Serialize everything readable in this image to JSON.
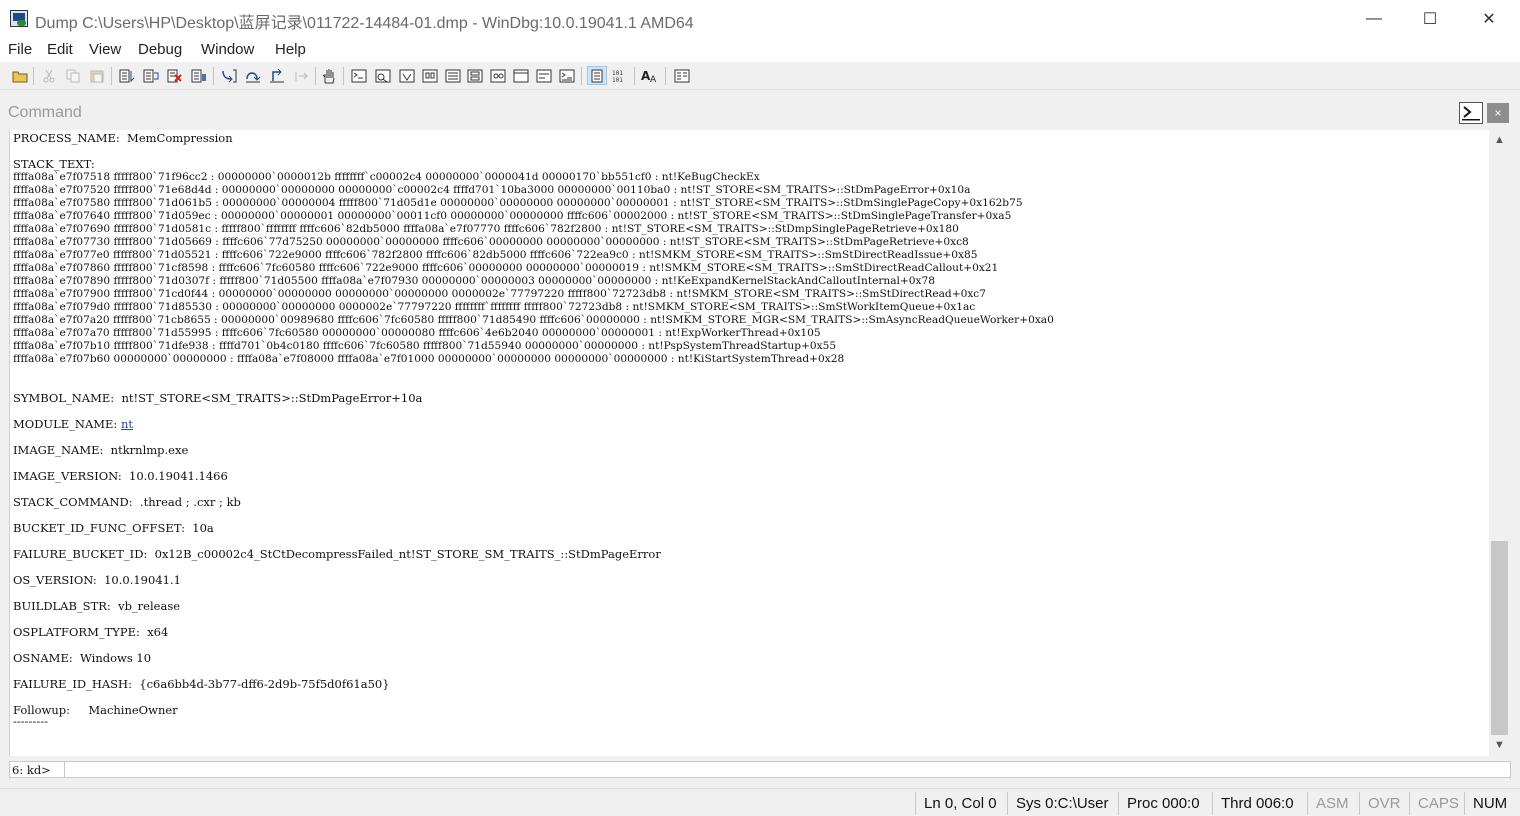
{
  "window": {
    "title": "Dump C:\\Users\\HP\\Desktop\\蓝屏记录\\011722-14484-01.dmp - WinDbg:10.0.19041.1 AMD64",
    "minimize": "—",
    "maximize": "☐",
    "close": "✕"
  },
  "menu": [
    "File",
    "Edit",
    "View",
    "Debug",
    "Window",
    "Help"
  ],
  "command_window": {
    "title": "Command",
    "close": "×",
    "prompt": "6: kd>",
    "input_value": ""
  },
  "output": {
    "process_name": "PROCESS_NAME:  MemCompression",
    "stack_text_header": "STACK_TEXT:",
    "stack": [
      "ffffa08a`e7f07518 fffff800`71f96cc2 : 00000000`0000012b ffffffff`c00002c4 00000000`0000041d 00000170`bb551cf0 : nt!KeBugCheckEx",
      "ffffa08a`e7f07520 fffff800`71e68d4d : 00000000`00000000 00000000`c00002c4 ffffd701`10ba3000 00000000`00110ba0 : nt!ST_STORE<SM_TRAITS>::StDmPageError+0x10a",
      "ffffa08a`e7f07580 fffff800`71d061b5 : 00000000`00000004 fffff800`71d05d1e 00000000`00000000 00000000`00000001 : nt!ST_STORE<SM_TRAITS>::StDmSinglePageCopy+0x162b75",
      "ffffa08a`e7f07640 fffff800`71d059ec : 00000000`00000001 00000000`00011cf0 00000000`00000000 ffffc606`00002000 : nt!ST_STORE<SM_TRAITS>::StDmSinglePageTransfer+0xa5",
      "ffffa08a`e7f07690 fffff800`71d0581c : fffff800`ffffffff ffffc606`82db5000 ffffa08a`e7f07770 ffffc606`782f2800 : nt!ST_STORE<SM_TRAITS>::StDmpSinglePageRetrieve+0x180",
      "ffffa08a`e7f07730 fffff800`71d05669 : ffffc606`77d75250 00000000`00000000 ffffc606`00000000 00000000`00000000 : nt!ST_STORE<SM_TRAITS>::StDmPageRetrieve+0xc8",
      "ffffa08a`e7f077e0 fffff800`71d05521 : ffffc606`722e9000 ffffc606`782f2800 ffffc606`82db5000 ffffc606`722ea9c0 : nt!SMKM_STORE<SM_TRAITS>::SmStDirectReadIssue+0x85",
      "ffffa08a`e7f07860 fffff800`71cf8598 : ffffc606`7fc60580 ffffc606`722e9000 ffffc606`00000000 00000000`00000019 : nt!SMKM_STORE<SM_TRAITS>::SmStDirectReadCallout+0x21",
      "ffffa08a`e7f07890 fffff800`71d0307f : fffff800`71d05500 ffffa08a`e7f07930 00000000`00000003 00000000`00000000 : nt!KeExpandKernelStackAndCalloutInternal+0x78",
      "ffffa08a`e7f07900 fffff800`71cd0f44 : 00000000`00000000 00000000`00000000 0000002e`77797220 fffff800`72723db8 : nt!SMKM_STORE<SM_TRAITS>::SmStDirectRead+0xc7",
      "ffffa08a`e7f079d0 fffff800`71d85530 : 00000000`00000000 0000002e`77797220 ffffffff`ffffffff fffff800`72723db8 : nt!SMKM_STORE<SM_TRAITS>::SmStWorkItemQueue+0x1ac",
      "ffffa08a`e7f07a20 fffff800`71cb8655 : 00000000`00989680 ffffc606`7fc60580 fffff800`71d85490 ffffc606`00000000 : nt!SMKM_STORE_MGR<SM_TRAITS>::SmAsyncReadQueueWorker+0xa0",
      "ffffa08a`e7f07a70 fffff800`71d55995 : ffffc606`7fc60580 00000000`00000080 ffffc606`4e6b2040 00000000`00000001 : nt!ExpWorkerThread+0x105",
      "ffffa08a`e7f07b10 fffff800`71dfe938 : ffffd701`0b4c0180 ffffc606`7fc60580 fffff800`71d55940 00000000`00000000 : nt!PspSystemThreadStartup+0x55",
      "ffffa08a`e7f07b60 00000000`00000000 : ffffa08a`e7f08000 ffffa08a`e7f01000 00000000`00000000 00000000`00000000 : nt!KiStartSystemThread+0x28"
    ],
    "symbol_name": "SYMBOL_NAME:  nt!ST_STORE<SM_TRAITS>::StDmPageError+10a",
    "module_name_label": "MODULE_NAME: ",
    "module_name_link": "nt",
    "image_name": "IMAGE_NAME:  ntkrnlmp.exe",
    "image_version": "IMAGE_VERSION:  10.0.19041.1466",
    "stack_command": "STACK_COMMAND:  .thread ; .cxr ; kb",
    "bucket_offset": "BUCKET_ID_FUNC_OFFSET:  10a",
    "failure_bucket": "FAILURE_BUCKET_ID:  0x12B_c00002c4_StCtDecompressFailed_nt!ST_STORE_SM_TRAITS_::StDmPageError",
    "os_version": "OS_VERSION:  10.0.19041.1",
    "buildlab": "BUILDLAB_STR:  vb_release",
    "osplatform": "OSPLATFORM_TYPE:  x64",
    "osname": "OSNAME:  Windows 10",
    "failure_hash": "FAILURE_ID_HASH:  {c6a6bb4d-3b77-dff6-2d9b-75f5d0f61a50}",
    "followup": "Followup:     MachineOwner",
    "separator": "---------"
  },
  "statusbar": {
    "position": "Ln 0, Col 0",
    "sys": "Sys 0:C:\\User",
    "proc": "Proc 000:0",
    "thrd": "Thrd 006:0",
    "asm": "ASM",
    "ovr": "OVR",
    "caps": "CAPS",
    "num": "NUM"
  },
  "colors": {
    "link": "#1a47b8",
    "selected_tool": "#cce4f7",
    "scroll_thumb": "#c7c7c7"
  }
}
